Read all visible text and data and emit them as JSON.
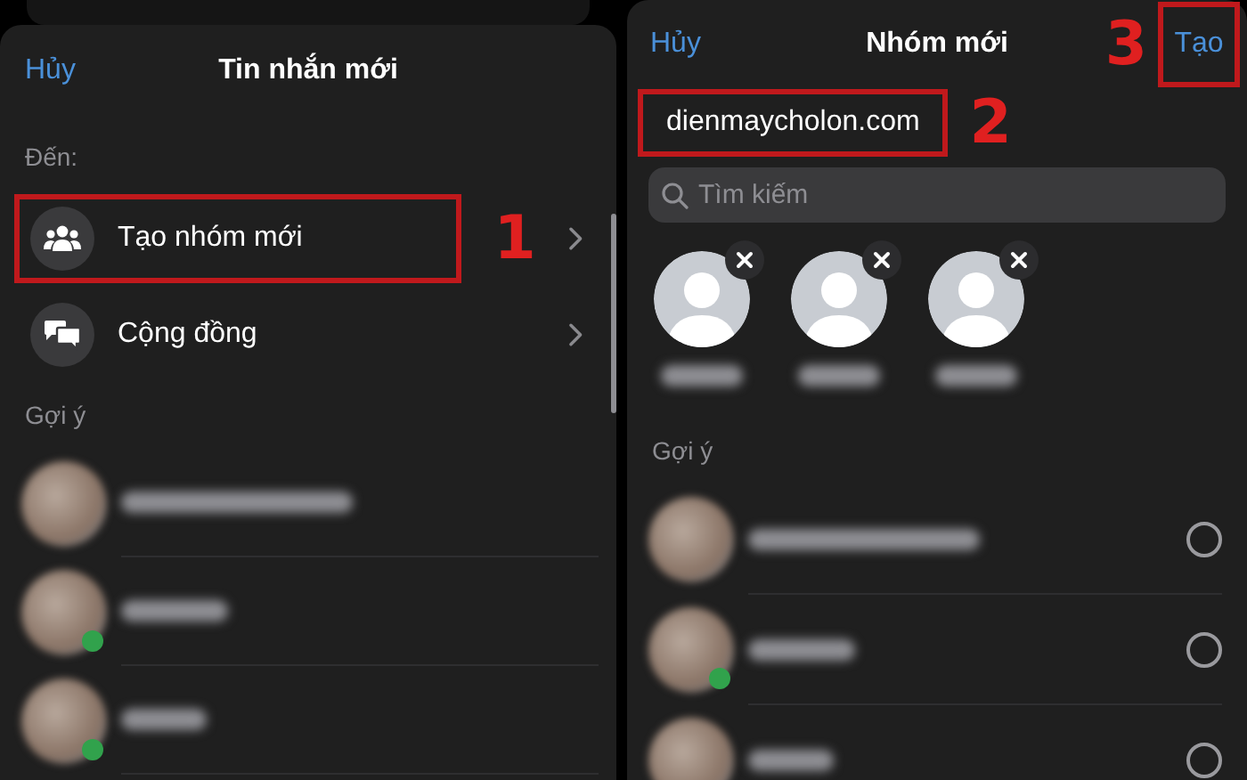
{
  "screen_new_message": {
    "cancel": "Hủy",
    "title": "Tin nhắn mới",
    "to_label": "Đến:",
    "options": [
      {
        "label": "Tạo nhóm mới",
        "kind": "group",
        "highlighted": true,
        "marker": "1"
      },
      {
        "label": "Cộng đồng",
        "kind": "community",
        "highlighted": false
      }
    ],
    "suggestions_label": "Gợi ý",
    "suggestions": [
      {
        "online": false
      },
      {
        "online": true
      },
      {
        "online": true
      }
    ]
  },
  "screen_new_group": {
    "cancel": "Hủy",
    "title": "Nhóm mới",
    "create": {
      "label": "Tạo",
      "highlighted": true,
      "marker": "3"
    },
    "group_name": {
      "value": "dienmaycholon.com",
      "highlighted": true,
      "marker": "2"
    },
    "search": {
      "placeholder": "Tìm kiếm"
    },
    "selected_people": [
      {
        "removable": true
      },
      {
        "removable": true
      },
      {
        "removable": true
      }
    ],
    "suggestions_label": "Gợi ý",
    "suggestions": [
      {
        "online": false,
        "checked": false
      },
      {
        "online": true,
        "checked": false
      },
      {
        "online": false,
        "checked": false
      }
    ]
  }
}
